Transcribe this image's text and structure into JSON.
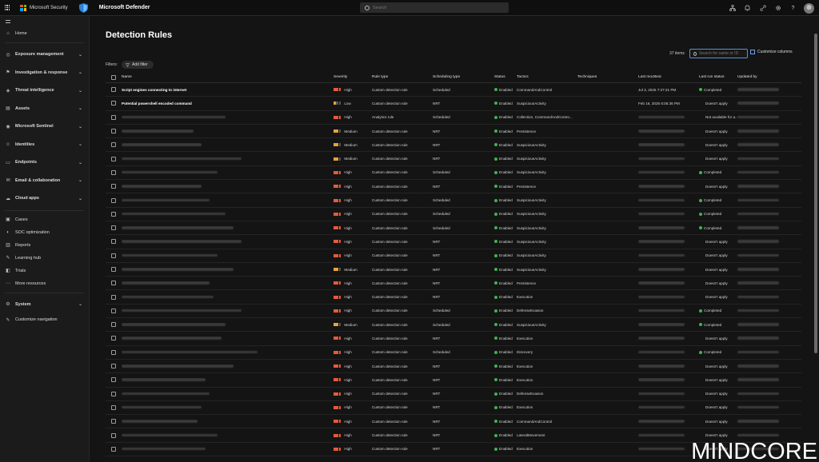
{
  "topbar": {
    "brand": "Microsoft Security",
    "product": "Microsoft Defender",
    "search_placeholder": "Search"
  },
  "sidebar": {
    "items": [
      {
        "label": "Home",
        "icon": "home-icon",
        "chevron": false,
        "bold": false
      },
      {
        "label": "Exposure management",
        "icon": "exposure-icon",
        "chevron": true,
        "bold": true
      },
      {
        "label": "Investigation & response",
        "icon": "investigation-icon",
        "chevron": true,
        "bold": true
      },
      {
        "label": "Threat intelligence",
        "icon": "threat-intel-icon",
        "chevron": true,
        "bold": true
      },
      {
        "label": "Assets",
        "icon": "assets-icon",
        "chevron": true,
        "bold": true
      },
      {
        "label": "Microsoft Sentinel",
        "icon": "sentinel-icon",
        "chevron": true,
        "bold": true
      },
      {
        "label": "Identities",
        "icon": "identities-icon",
        "chevron": true,
        "bold": true
      },
      {
        "label": "Endpoints",
        "icon": "endpoints-icon",
        "chevron": true,
        "bold": true
      },
      {
        "label": "Email & collaboration",
        "icon": "email-icon",
        "chevron": true,
        "bold": true
      },
      {
        "label": "Cloud apps",
        "icon": "cloud-icon",
        "chevron": true,
        "bold": true
      },
      {
        "label": "Cases",
        "icon": "cases-icon",
        "chevron": false,
        "bold": false
      },
      {
        "label": "SOC optimization",
        "icon": "soc-icon",
        "chevron": false,
        "bold": false
      },
      {
        "label": "Reports",
        "icon": "reports-icon",
        "chevron": false,
        "bold": false
      },
      {
        "label": "Learning hub",
        "icon": "learning-icon",
        "chevron": false,
        "bold": false
      },
      {
        "label": "Trials",
        "icon": "trials-icon",
        "chevron": false,
        "bold": false
      },
      {
        "label": "More resources",
        "icon": "more-icon",
        "chevron": false,
        "bold": false
      },
      {
        "label": "System",
        "icon": "system-icon",
        "chevron": true,
        "bold": true
      },
      {
        "label": "Customize navigation",
        "icon": "pencil-icon",
        "chevron": false,
        "bold": false
      }
    ]
  },
  "main": {
    "title": "Detection Rules",
    "filters_label": "Filters:",
    "add_filter": "Add filter",
    "count": "37 items",
    "search_placeholder": "Search for name or ID",
    "customize_columns": "Customize columns",
    "columns": [
      "Name",
      "Severity",
      "Rule type",
      "Scheduling type",
      "Status",
      "Tactics",
      "Techniques",
      "Last modified",
      "Last run status",
      "Updated by"
    ]
  },
  "colors": {
    "high": "#e8593a",
    "medium": "#e8a33a",
    "low": "#e8a33a",
    "enabled": "#3fb34f"
  },
  "rows": [
    {
      "name": "Script engines connecting to internet",
      "severity": "High",
      "type": "Custom detection rule",
      "sched": "Scheduled",
      "status": "Enabled",
      "tactics": "CommandAndControl",
      "modified": "Jul 3, 2025 7:27:21 PM",
      "run": "Completed"
    },
    {
      "name": "Potential powershell encoded command",
      "severity": "Low",
      "type": "Custom detection rule",
      "sched": "NRT",
      "status": "Enabled",
      "tactics": "SuspiciousActivity",
      "modified": "Feb 16, 2025 6:05:36 PM",
      "run": "Doesn't apply"
    },
    {
      "name": "",
      "severity": "High",
      "type": "Analytics rule",
      "sched": "Scheduled",
      "status": "Enabled",
      "tactics": "Collection, CommandAndContro...",
      "modified": "",
      "run": "Not available for a..."
    },
    {
      "name": "",
      "severity": "Medium",
      "type": "Custom detection rule",
      "sched": "NRT",
      "status": "Enabled",
      "tactics": "Persistence",
      "modified": "",
      "run": "Doesn't apply"
    },
    {
      "name": "",
      "severity": "Medium",
      "type": "Custom detection rule",
      "sched": "NRT",
      "status": "Enabled",
      "tactics": "SuspiciousActivity",
      "modified": "",
      "run": "Doesn't apply"
    },
    {
      "name": "",
      "severity": "Medium",
      "type": "Custom detection rule",
      "sched": "NRT",
      "status": "Enabled",
      "tactics": "SuspiciousActivity",
      "modified": "",
      "run": "Doesn't apply"
    },
    {
      "name": "",
      "severity": "High",
      "type": "Custom detection rule",
      "sched": "Scheduled",
      "status": "Enabled",
      "tactics": "SuspiciousActivity",
      "modified": "",
      "run": "Completed"
    },
    {
      "name": "",
      "severity": "High",
      "type": "Custom detection rule",
      "sched": "NRT",
      "status": "Enabled",
      "tactics": "Persistence",
      "modified": "",
      "run": "Doesn't apply"
    },
    {
      "name": "",
      "severity": "High",
      "type": "Custom detection rule",
      "sched": "Scheduled",
      "status": "Enabled",
      "tactics": "SuspiciousActivity",
      "modified": "",
      "run": "Completed"
    },
    {
      "name": "",
      "severity": "High",
      "type": "Custom detection rule",
      "sched": "Scheduled",
      "status": "Enabled",
      "tactics": "SuspiciousActivity",
      "modified": "",
      "run": "Completed"
    },
    {
      "name": "",
      "severity": "High",
      "type": "Custom detection rule",
      "sched": "Scheduled",
      "status": "Enabled",
      "tactics": "SuspiciousActivity",
      "modified": "",
      "run": "Completed"
    },
    {
      "name": "",
      "severity": "High",
      "type": "Custom detection rule",
      "sched": "NRT",
      "status": "Enabled",
      "tactics": "SuspiciousActivity",
      "modified": "",
      "run": "Doesn't apply"
    },
    {
      "name": "",
      "severity": "High",
      "type": "Custom detection rule",
      "sched": "NRT",
      "status": "Enabled",
      "tactics": "SuspiciousActivity",
      "modified": "",
      "run": "Doesn't apply"
    },
    {
      "name": "",
      "severity": "Medium",
      "type": "Custom detection rule",
      "sched": "NRT",
      "status": "Enabled",
      "tactics": "SuspiciousActivity",
      "modified": "",
      "run": "Doesn't apply"
    },
    {
      "name": "",
      "severity": "High",
      "type": "Custom detection rule",
      "sched": "NRT",
      "status": "Enabled",
      "tactics": "Persistence",
      "modified": "",
      "run": "Doesn't apply"
    },
    {
      "name": "",
      "severity": "High",
      "type": "Custom detection rule",
      "sched": "NRT",
      "status": "Enabled",
      "tactics": "Execution",
      "modified": "",
      "run": "Doesn't apply"
    },
    {
      "name": "",
      "severity": "High",
      "type": "Custom detection rule",
      "sched": "Scheduled",
      "status": "Enabled",
      "tactics": "DefenseEvasion",
      "modified": "",
      "run": "Completed"
    },
    {
      "name": "",
      "severity": "Medium",
      "type": "Custom detection rule",
      "sched": "Scheduled",
      "status": "Enabled",
      "tactics": "SuspiciousActivity",
      "modified": "",
      "run": "Completed"
    },
    {
      "name": "",
      "severity": "High",
      "type": "Custom detection rule",
      "sched": "NRT",
      "status": "Enabled",
      "tactics": "Execution",
      "modified": "",
      "run": "Doesn't apply"
    },
    {
      "name": "",
      "severity": "High",
      "type": "Custom detection rule",
      "sched": "Scheduled",
      "status": "Enabled",
      "tactics": "Discovery",
      "modified": "",
      "run": "Completed"
    },
    {
      "name": "",
      "severity": "High",
      "type": "Custom detection rule",
      "sched": "NRT",
      "status": "Enabled",
      "tactics": "Execution",
      "modified": "",
      "run": "Doesn't apply"
    },
    {
      "name": "",
      "severity": "High",
      "type": "Custom detection rule",
      "sched": "NRT",
      "status": "Enabled",
      "tactics": "Execution",
      "modified": "",
      "run": "Doesn't apply"
    },
    {
      "name": "",
      "severity": "High",
      "type": "Custom detection rule",
      "sched": "NRT",
      "status": "Enabled",
      "tactics": "DefenseEvasion",
      "modified": "",
      "run": "Doesn't apply"
    },
    {
      "name": "",
      "severity": "High",
      "type": "Custom detection rule",
      "sched": "NRT",
      "status": "Enabled",
      "tactics": "Execution",
      "modified": "",
      "run": "Doesn't apply"
    },
    {
      "name": "",
      "severity": "High",
      "type": "Custom detection rule",
      "sched": "NRT",
      "status": "Enabled",
      "tactics": "CommandAndControl",
      "modified": "",
      "run": "Doesn't apply"
    },
    {
      "name": "",
      "severity": "High",
      "type": "Custom detection rule",
      "sched": "NRT",
      "status": "Enabled",
      "tactics": "LateralMovement",
      "modified": "",
      "run": "Doesn't apply"
    },
    {
      "name": "",
      "severity": "High",
      "type": "Custom detection rule",
      "sched": "NRT",
      "status": "Enabled",
      "tactics": "Execution",
      "modified": "",
      "run": "Doesn't apply"
    }
  ],
  "watermark": "MINDCORE"
}
